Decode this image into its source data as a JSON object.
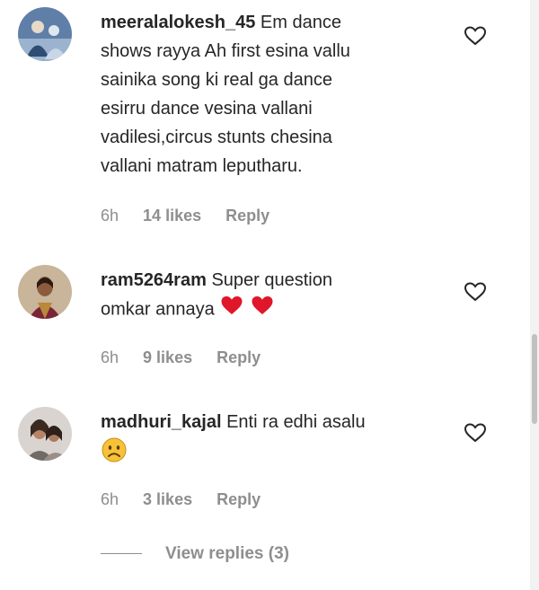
{
  "comments": [
    {
      "username": "meeralalokesh_45",
      "lines": [
        "Em dance",
        "shows rayya Ah first esina vallu",
        "sainika song ki real ga dance",
        "esirru dance vesina vallani",
        "vadilesi,circus stunts chesina",
        "vallani matram leputharu."
      ],
      "time": "6h",
      "likes": "14 likes",
      "reply": "Reply"
    },
    {
      "username": "ram5264ram",
      "lines": [
        "Super question",
        "omkar annaya"
      ],
      "emoji": [
        "red-heart",
        "red-heart"
      ],
      "time": "6h",
      "likes": "9 likes",
      "reply": "Reply"
    },
    {
      "username": "madhuri_kajal",
      "lines": [
        "Enti ra edhi asalu"
      ],
      "emoji": [
        "disappointed-face"
      ],
      "time": "6h",
      "likes": "3 likes",
      "reply": "Reply"
    }
  ],
  "view_replies": "View replies (3)",
  "colors": {
    "text": "#262626",
    "muted": "#8e8e8e",
    "heart": "#e0162b"
  }
}
